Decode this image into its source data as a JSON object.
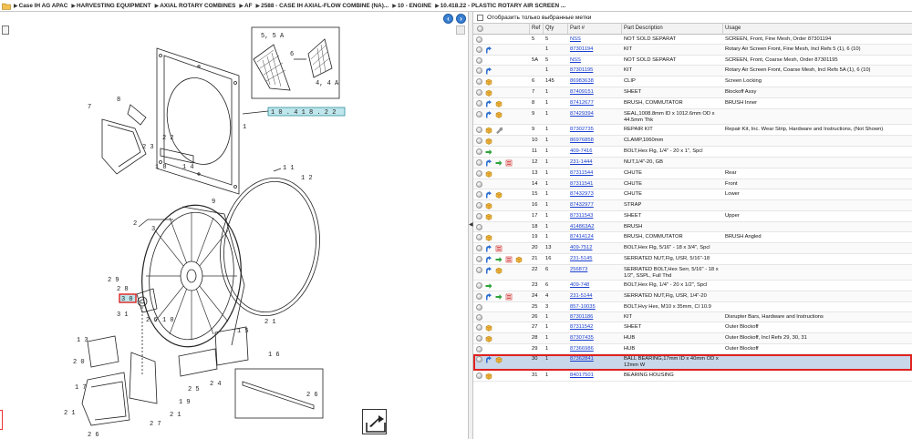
{
  "breadcrumb": [
    "Case IH AG APAC",
    "HARVESTING EQUIPMENT",
    "AXIAL ROTARY COMBINES",
    "AF",
    "2588 - CASE IH AXIAL-FLOW COMBINE (NA)...",
    "10 - ENGINE",
    "10.418.22 - PLASTIC ROTARY AIR SCREEN ..."
  ],
  "filter": {
    "label": "Отобразить только выбранные метки"
  },
  "table": {
    "headers": [
      "Ref",
      "Qty",
      "Part #",
      "Part Description",
      "Usage"
    ],
    "selected_index": 29,
    "rows": [
      {
        "icons": [],
        "ref": "5",
        "qty": "5",
        "part": "NSS",
        "desc": "NOT SOLD SEPARAT",
        "usage": "SCREEN, Front, Fine Mesh, Order 87301194"
      },
      {
        "icons": [
          "arrow-blue"
        ],
        "ref": "",
        "qty": "1",
        "part": "87301194",
        "desc": "KIT",
        "usage": "Rotary Air Screen Front, Fine Mesh, Incl Refs 5 (1), 6 (10)"
      },
      {
        "icons": [],
        "ref": "5A",
        "qty": "5",
        "part": "NSS",
        "desc": "NOT SOLD SEPARAT",
        "usage": "SCREEN, Front, Coarse Mesh, Order 87301195"
      },
      {
        "icons": [
          "arrow-blue"
        ],
        "ref": "",
        "qty": "1",
        "part": "87301195",
        "desc": "KIT",
        "usage": "Rotary Air Screen Front, Coarse Mesh, Incl Refs 5A (1), 6 (10)"
      },
      {
        "icons": [
          "box"
        ],
        "ref": "6",
        "qty": "145",
        "part": "86983638",
        "desc": "CLIP",
        "usage": "Screen Locking"
      },
      {
        "icons": [
          "box"
        ],
        "ref": "7",
        "qty": "1",
        "part": "87409151",
        "desc": "SHEET",
        "usage": "Blockoff Assy"
      },
      {
        "icons": [
          "arrow-blue",
          "box"
        ],
        "ref": "8",
        "qty": "1",
        "part": "87412677",
        "desc": "BRUSH, COMMUTATOR",
        "usage": "BRUSH Inner"
      },
      {
        "icons": [
          "arrow-blue",
          "box"
        ],
        "ref": "9",
        "qty": "1",
        "part": "87429394",
        "desc": "SEAL,1008.8mm ID x 1012.6mm OD x 44.5mm Thk",
        "usage": ""
      },
      {
        "icons": [
          "box",
          "wrench"
        ],
        "ref": "9",
        "qty": "1",
        "part": "87302735",
        "desc": "REPAIR KIT",
        "usage": "Repair Kit, Inc. Wear Strip, Hardware and Instructions, (Not Shown)"
      },
      {
        "icons": [
          "box"
        ],
        "ref": "10",
        "qty": "1",
        "part": "86976858",
        "desc": "CLAMP,1060mm",
        "usage": ""
      },
      {
        "icons": [
          "arrow-green"
        ],
        "ref": "11",
        "qty": "1",
        "part": "409-7416",
        "desc": "BOLT,Hex Flg, 1/4\" - 20 x 1\", Spcl",
        "usage": ""
      },
      {
        "icons": [
          "arrow-blue",
          "arrow-green",
          "doc"
        ],
        "ref": "12",
        "qty": "1",
        "part": "231-1444",
        "desc": "NUT,1/4\"-20, GB",
        "usage": ""
      },
      {
        "icons": [
          "box"
        ],
        "ref": "13",
        "qty": "1",
        "part": "87311544",
        "desc": "CHUTE",
        "usage": "Rear"
      },
      {
        "icons": [],
        "ref": "14",
        "qty": "1",
        "part": "87311541",
        "desc": "CHUTE",
        "usage": "Front"
      },
      {
        "icons": [
          "arrow-blue",
          "box"
        ],
        "ref": "15",
        "qty": "1",
        "part": "87432973",
        "desc": "CHUTE",
        "usage": "Lower"
      },
      {
        "icons": [
          "box"
        ],
        "ref": "16",
        "qty": "1",
        "part": "87432977",
        "desc": "STRAP",
        "usage": ""
      },
      {
        "icons": [
          "box"
        ],
        "ref": "17",
        "qty": "1",
        "part": "87311543",
        "desc": "SHEET",
        "usage": "Upper"
      },
      {
        "icons": [],
        "ref": "18",
        "qty": "1",
        "part": "414863A2",
        "desc": "BRUSH",
        "usage": ""
      },
      {
        "icons": [
          "box"
        ],
        "ref": "19",
        "qty": "1",
        "part": "87414124",
        "desc": "BRUSH, COMMUTATOR",
        "usage": "BRUSH Angled"
      },
      {
        "icons": [
          "arrow-blue",
          "doc"
        ],
        "ref": "20",
        "qty": "13",
        "part": "409-7512",
        "desc": "BOLT,Hex Flg, 5/16\" - 18 x 3/4\", Spcl",
        "usage": ""
      },
      {
        "icons": [
          "arrow-blue",
          "arrow-green",
          "doc",
          "box"
        ],
        "ref": "21",
        "qty": "16",
        "part": "231-5145",
        "desc": "SERRATED NUT,Flg, USR, 5/16\"-18",
        "usage": ""
      },
      {
        "icons": [
          "arrow-blue",
          "box"
        ],
        "ref": "22",
        "qty": "6",
        "part": "256873",
        "desc": "SERRATED BOLT,Hex Serr, 5/16\" - 18 x 1/2\", SSPL, Full Thd",
        "usage": ""
      },
      {
        "icons": [
          "arrow-green"
        ],
        "ref": "23",
        "qty": "6",
        "part": "409-748",
        "desc": "BOLT,Hex Flg, 1/4\" - 20 x 1/2\", Spcl",
        "usage": ""
      },
      {
        "icons": [
          "arrow-blue",
          "arrow-green",
          "doc"
        ],
        "ref": "24",
        "qty": "4",
        "part": "231-5144",
        "desc": "SERRATED NUT,Flg, USR, 1/4\"-20",
        "usage": ""
      },
      {
        "icons": [],
        "ref": "25",
        "qty": "3",
        "part": "857-10035",
        "desc": "BOLT,Hvy Hex, M10 x 35mm, Cl 10.9",
        "usage": ""
      },
      {
        "icons": [],
        "ref": "26",
        "qty": "1",
        "part": "87301186",
        "desc": "KIT",
        "usage": "Disrupter Bars, Hardware and Instructions"
      },
      {
        "icons": [
          "box"
        ],
        "ref": "27",
        "qty": "1",
        "part": "87311542",
        "desc": "SHEET",
        "usage": "Outer Blockoff"
      },
      {
        "icons": [
          "box"
        ],
        "ref": "28",
        "qty": "1",
        "part": "87307435",
        "desc": "HUB",
        "usage": "Outer Blockoff, Incl Refs 29, 30, 31"
      },
      {
        "icons": [],
        "ref": "29",
        "qty": "1",
        "part": "87366986",
        "desc": "HUB",
        "usage": "Outer Blockoff"
      },
      {
        "icons": [
          "arrow-blue",
          "box"
        ],
        "ref": "30",
        "qty": "1",
        "part": "87362841",
        "desc": "BALL BEARING,17mm ID x 40mm OD x 12mm W",
        "usage": ""
      },
      {
        "icons": [
          "box"
        ],
        "ref": "31",
        "qty": "1",
        "part": "84017501",
        "desc": "BEARING HOUSING",
        "usage": ""
      }
    ]
  },
  "diagram": {
    "callouts": [
      "5, 5 A",
      "6",
      "4, 4 A",
      "1 0 . 4 1 8 . 2 2",
      "8",
      "7",
      "2 2",
      "2 3",
      "1 8",
      "1 4",
      "1",
      "1 1",
      "1 2",
      "9",
      "3",
      "2",
      "2 9",
      "2 8",
      "3 0",
      "3 1",
      "2 6",
      "1 0",
      "1 3",
      "2 0",
      "2 1",
      "1 7",
      "2 7",
      "2 5",
      "1 9",
      "2 4",
      "1 6",
      "1 5",
      "2 1",
      "2 1",
      "2 6"
    ]
  }
}
